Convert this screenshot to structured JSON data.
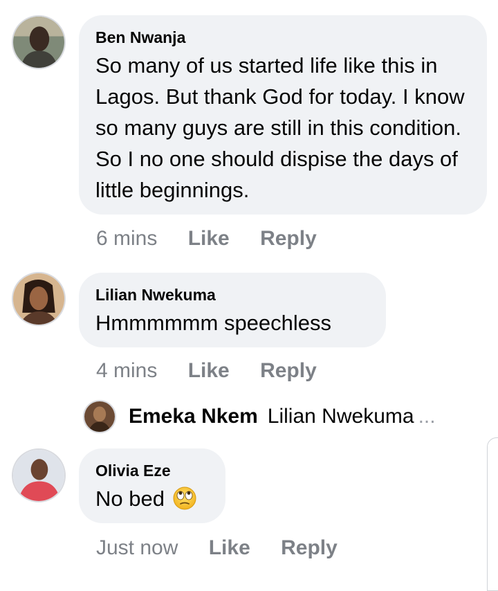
{
  "comments": [
    {
      "author": "Ben Nwanja",
      "text": "So many of us started life like this in Lagos. But thank God for today. I know so many guys are still in this condition. So I no one should dispise the days of little beginnings.",
      "time": "6 mins",
      "like_label": "Like",
      "reply_label": "Reply"
    },
    {
      "author": "Lilian Nwekuma",
      "text": "Hmmmmmm speechless",
      "time": "4 mins",
      "like_label": "Like",
      "reply_label": "Reply"
    },
    {
      "author": "Olivia Eze",
      "text": "No bed",
      "emoji": "eye-roll-emoji",
      "time": "Just now",
      "like_label": "Like",
      "reply_label": "Reply"
    }
  ],
  "reply_preview": {
    "author": "Emeka Nkem",
    "text": "Lilian Nwekuma",
    "more": "..."
  },
  "colors": {
    "bubble": "#f0f2f5",
    "meta_text": "#7d8187",
    "primary_text": "#050505"
  }
}
